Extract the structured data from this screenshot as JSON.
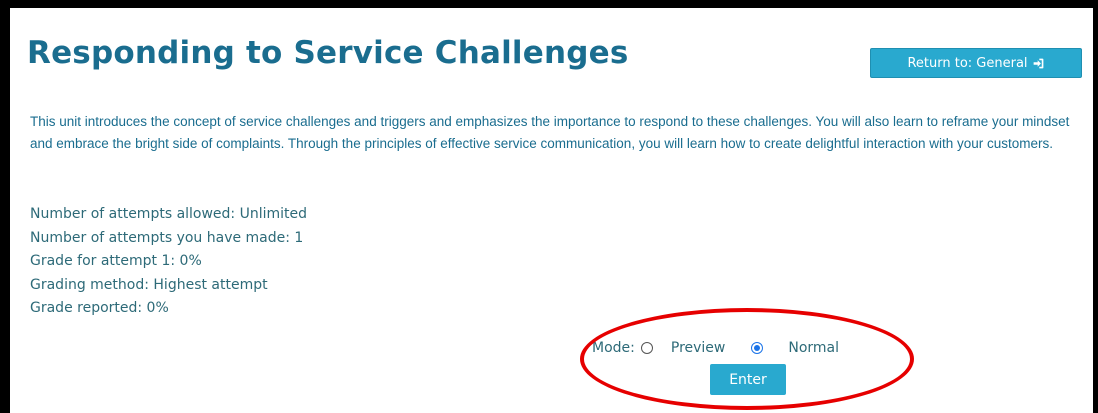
{
  "header": {
    "title": "Responding to Service Challenges",
    "return_button_label": "Return to: General"
  },
  "description": "This unit introduces the concept of service challenges and triggers and emphasizes the importance to respond to these challenges. You will also learn to reframe your mindset and embrace the bright side of complaints. Through the principles of effective service communication, you will learn how to create delightful interaction with your customers.",
  "attempt_info": [
    "Number of attempts allowed: Unlimited",
    "Number of attempts you have made: 1",
    "Grade for attempt 1: 0%",
    "Grading method: Highest attempt",
    "Grade reported: 0%"
  ],
  "mode": {
    "label": "Mode:",
    "options": [
      "Preview",
      "Normal"
    ],
    "selected": "Normal"
  },
  "enter_button_label": "Enter",
  "colors": {
    "title": "#1a6d8f",
    "button": "#29a9cf",
    "highlight": "#e60000"
  }
}
